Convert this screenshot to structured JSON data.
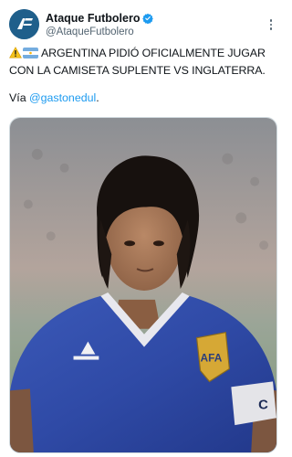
{
  "account": {
    "display_name": "Ataque Futbolero",
    "handle": "@AtaqueFutbolero",
    "avatar_icon": "af-logo-icon",
    "verified_icon": "verified-badge-icon",
    "more_icon": "more-options-icon"
  },
  "tweet": {
    "line1": "ARGENTINA PIDIÓ OFICIALMENTE JUGAR",
    "line2": "CON LA CAMISETA SUPLENTE VS INGLATERRA.",
    "via_prefix": "Vía ",
    "mention": "@gastonedul",
    "via_suffix": ".",
    "emojis": [
      "warning-icon",
      "argentina-flag-icon"
    ]
  },
  "media": {
    "jersey_captain_letter": "C",
    "crest_text": "AFA"
  },
  "colors": {
    "link": "#1d9bf0",
    "verified": "#1d9bf0",
    "avatar_bg": "#1f5f8b",
    "jersey": "#2f4aa6"
  }
}
